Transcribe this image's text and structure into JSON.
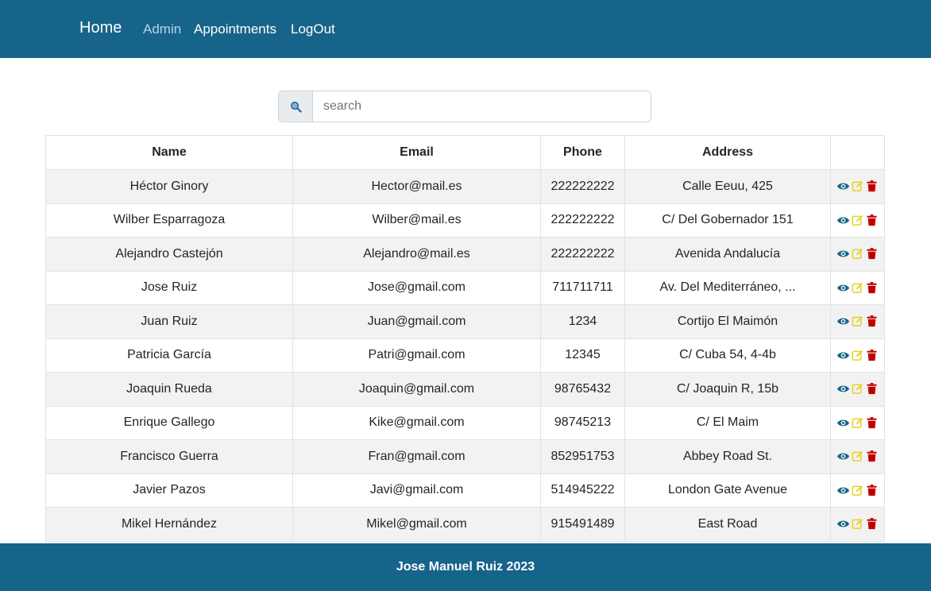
{
  "nav": {
    "brand": "Home",
    "links": [
      "Admin",
      "Appointments",
      "LogOut"
    ]
  },
  "search": {
    "placeholder": "search",
    "value": ""
  },
  "table": {
    "headers": [
      "Name",
      "Email",
      "Phone",
      "Address",
      ""
    ],
    "rows": [
      [
        "Héctor Ginory",
        "Hector@mail.es",
        "222222222",
        "Calle Eeuu, 425"
      ],
      [
        "Wilber Esparragoza",
        "Wilber@mail.es",
        "222222222",
        "C/ Del Gobernador 151"
      ],
      [
        "Alejandro Castejón",
        "Alejandro@mail.es",
        "222222222",
        "Avenida Andalucía"
      ],
      [
        "Jose Ruiz",
        "Jose@gmail.com",
        "711711711",
        "Av. Del Mediterráneo, ..."
      ],
      [
        "Juan Ruiz",
        "Juan@gmail.com",
        "1234",
        "Cortijo El Maimón"
      ],
      [
        "Patricia García",
        "Patri@gmail.com",
        "12345",
        "C/ Cuba 54, 4-4b"
      ],
      [
        "Joaquin Rueda",
        "Joaquin@gmail.com",
        "98765432",
        "C/ Joaquin R, 15b"
      ],
      [
        "Enrique Gallego",
        "Kike@gmail.com",
        "98745213",
        "C/ El Maim"
      ],
      [
        "Francisco Guerra",
        "Fran@gmail.com",
        "852951753",
        "Abbey Road St."
      ],
      [
        "Javier Pazos",
        "Javi@gmail.com",
        "514945222",
        "London Gate Avenue"
      ],
      [
        "Mikel Hernández",
        "Mikel@gmail.com",
        "915491489",
        "East Road"
      ]
    ],
    "row_actions": [
      "eye-icon",
      "edit-icon",
      "trash-icon"
    ]
  },
  "footer": {
    "text": "Jose Manuel Ruiz 2023"
  },
  "colors": {
    "primary": "#17648a",
    "view_icon": "#17648a",
    "edit_icon": "#e6d11f",
    "delete_icon": "#c00000"
  }
}
